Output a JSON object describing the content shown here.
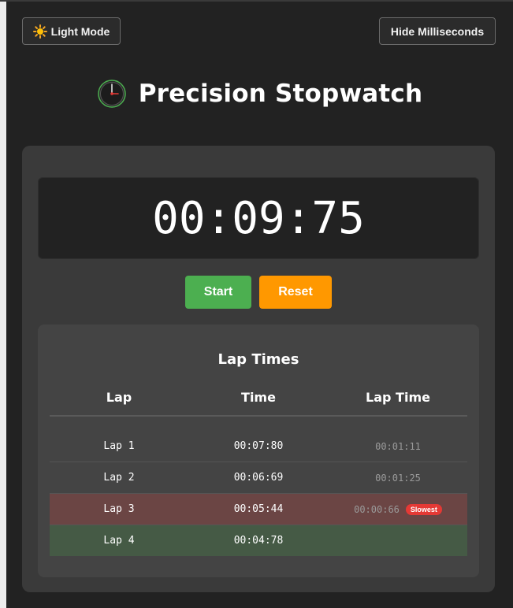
{
  "header": {
    "theme_button": "Light Mode",
    "theme_icon": "sun-icon",
    "ms_button": "Hide Milliseconds"
  },
  "title": "Precision Stopwatch",
  "display": {
    "time": "00:09:75"
  },
  "controls": {
    "start": "Start",
    "reset": "Reset"
  },
  "laps": {
    "title": "Lap Times",
    "columns": [
      "Lap",
      "Time",
      "Lap Time"
    ],
    "rows": [
      {
        "lap": "Lap 1",
        "time": "00:07:80",
        "lap_time": "00:01:11",
        "badge": "",
        "status": "normal"
      },
      {
        "lap": "Lap 2",
        "time": "00:06:69",
        "lap_time": "00:01:25",
        "badge": "",
        "status": "normal"
      },
      {
        "lap": "Lap 3",
        "time": "00:05:44",
        "lap_time": "00:00:66",
        "badge": "Slowest",
        "status": "slowest"
      },
      {
        "lap": "Lap 4",
        "time": "00:04:78",
        "lap_time": "",
        "badge": "",
        "status": "fastest"
      }
    ]
  },
  "colors": {
    "start": "#4caf50",
    "reset": "#ff9800",
    "slowest_row": "#6b4544",
    "fastest_row": "#455a45",
    "badge": "#e53935"
  }
}
